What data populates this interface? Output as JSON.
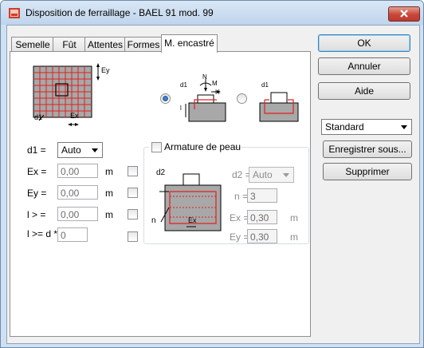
{
  "window": {
    "title": "Disposition de ferraillage - BAEL 91 mod. 99"
  },
  "tabs": [
    {
      "label": "Semelle"
    },
    {
      "label": "Fût"
    },
    {
      "label": "Attentes"
    },
    {
      "label": "Formes"
    },
    {
      "label": "M. encastré"
    }
  ],
  "diagram": {
    "ey_label": "Ey",
    "d1_label": "d1",
    "ex_label": "Ex"
  },
  "options": {
    "d1": "d1",
    "n": "N",
    "m": "M",
    "h": "H",
    "l": "l",
    "d1_right": "d1"
  },
  "form": {
    "d1_label": "d1 =",
    "d1_value": "Auto",
    "ex_label": "Ex =",
    "ex_value": "0,00",
    "ex_unit": "m",
    "ey_label": "Ey =",
    "ey_value": "0,00",
    "ey_unit": "m",
    "l_label": "l > =",
    "l_value": "0,00",
    "l_unit": "m",
    "ld_label": "l >= d *",
    "ld_value": "0"
  },
  "peau": {
    "checkbox_label": "Armature de peau",
    "d2_diagram": "d2",
    "n_diagram": "n",
    "ex_diagram": "Ex",
    "d2_label": "d2 =",
    "d2_value": "Auto",
    "n_label": "n =",
    "n_value": "3",
    "ex_label": "Ex =",
    "ex_value": "0,30",
    "ex_unit": "m",
    "ey_label": "Ey =",
    "ey_value": "0,30",
    "ey_unit": "m"
  },
  "buttons": {
    "ok": "OK",
    "cancel": "Annuler",
    "help": "Aide",
    "save_as": "Enregistrer sous...",
    "delete": "Supprimer"
  },
  "preset": {
    "value": "Standard"
  },
  "colors": {
    "rebar": "#e02020",
    "concrete": "#a8a8a8",
    "titlebar": "#c9dbef",
    "close": "#c7463a"
  }
}
